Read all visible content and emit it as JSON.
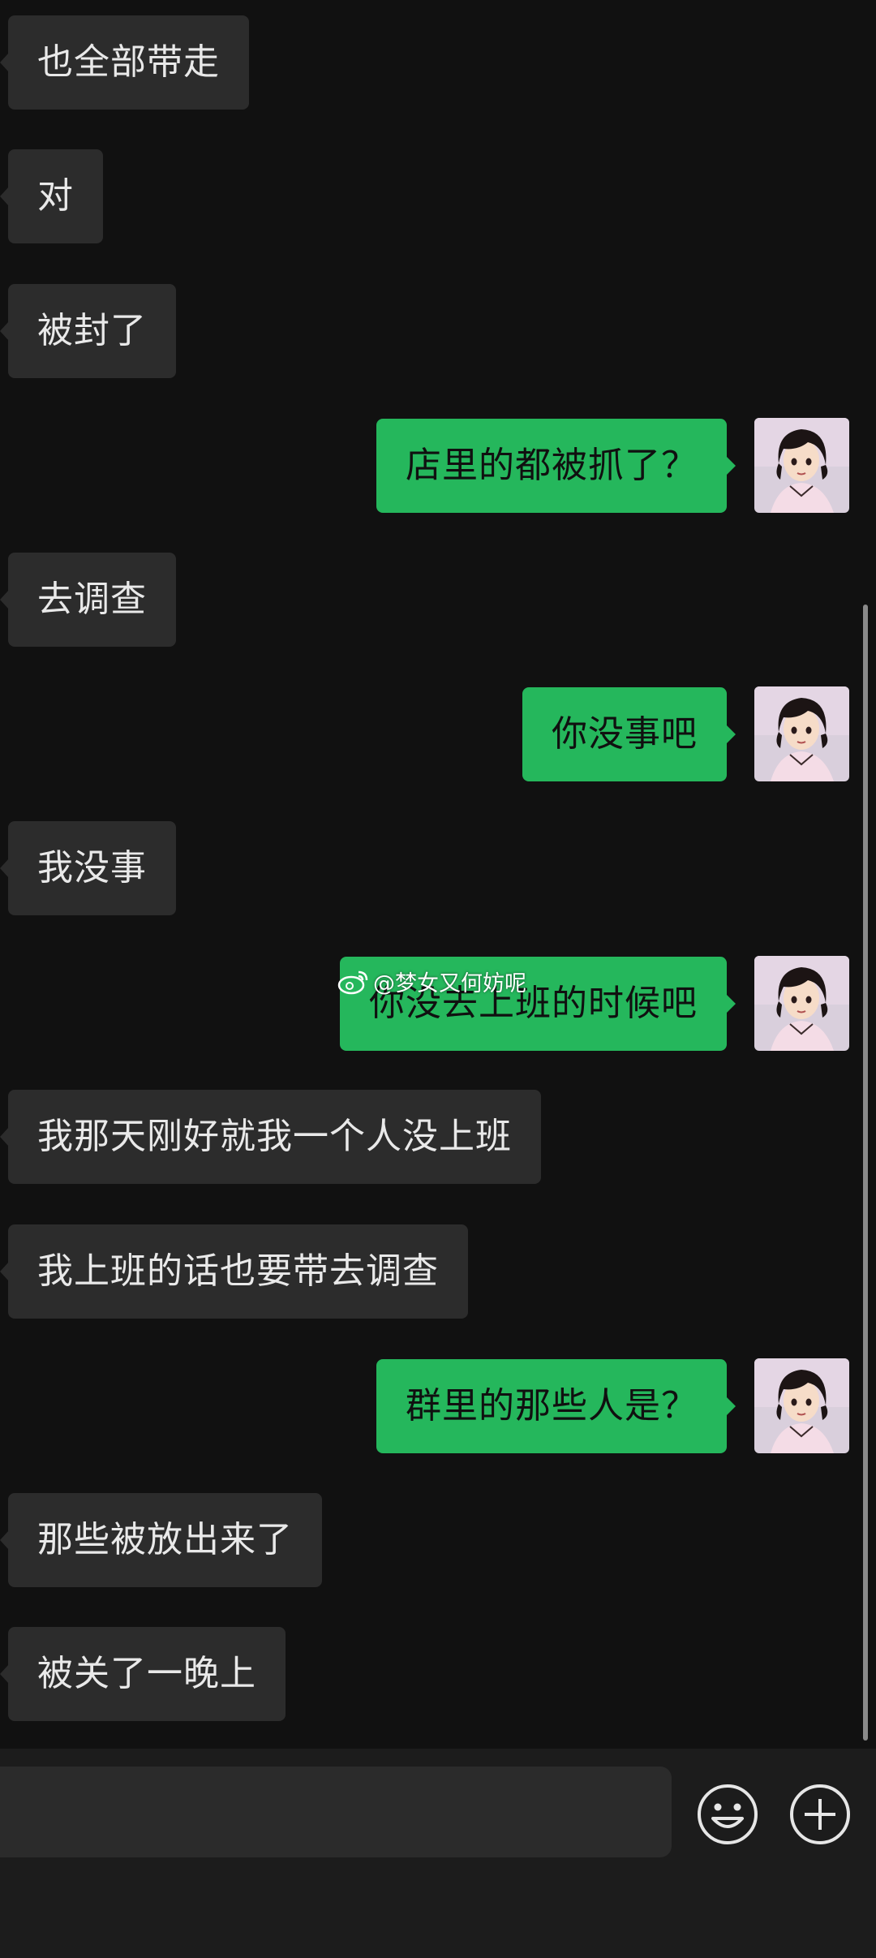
{
  "messages": [
    {
      "side": "left",
      "text": "也全部带走"
    },
    {
      "side": "left",
      "text": "对"
    },
    {
      "side": "left",
      "text": "被封了"
    },
    {
      "side": "right",
      "text": "店里的都被抓了？"
    },
    {
      "side": "left",
      "text": "去调查"
    },
    {
      "side": "right",
      "text": "你没事吧"
    },
    {
      "side": "left",
      "text": "我没事"
    },
    {
      "side": "right",
      "text": "你没去上班的时候吧"
    },
    {
      "side": "left",
      "text": "我那天刚好就我一个人没上班"
    },
    {
      "side": "left",
      "text": "我上班的话也要带去调查"
    },
    {
      "side": "right",
      "text": "群里的那些人是？"
    },
    {
      "side": "left",
      "text": "那些被放出来了"
    },
    {
      "side": "left",
      "text": "被关了一晚上"
    }
  ],
  "watermark": {
    "text": "@梦女又何妨呢",
    "icon": "weibo-icon"
  },
  "input": {
    "value": "",
    "placeholder": ""
  },
  "icons": {
    "emoji": "emoji-icon",
    "more": "plus-circle-icon",
    "avatar": "avatar-image"
  },
  "colors": {
    "background": "#111111",
    "incoming_bubble": "#2c2c2c",
    "outgoing_bubble": "#25b75c",
    "input_bar": "#1c1c1c"
  }
}
